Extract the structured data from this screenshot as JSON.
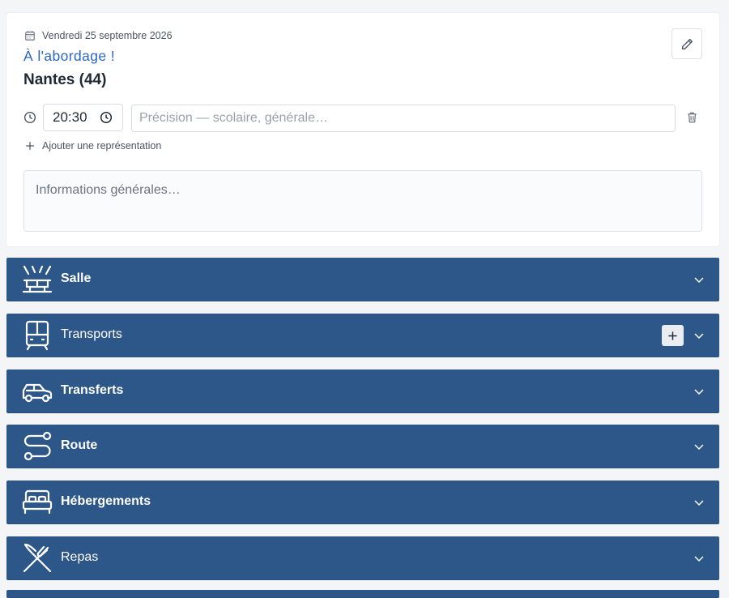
{
  "header": {
    "date": "Vendredi 25 septembre 2026",
    "title": "À l'abordage !",
    "city": "Nantes (44)"
  },
  "performance": {
    "time": "20:30",
    "precision_placeholder": "Précision — scolaire, générale…"
  },
  "add_representation_label": "Ajouter une représentation",
  "info_placeholder": "Informations générales…",
  "sections": [
    {
      "label": "Salle",
      "icon": "venue-icon"
    },
    {
      "label": "Transports",
      "icon": "train-icon"
    },
    {
      "label": "Transferts",
      "icon": "car-icon"
    },
    {
      "label": "Route",
      "icon": "route-icon"
    },
    {
      "label": "Hébergements",
      "icon": "bed-icon"
    },
    {
      "label": "Repas",
      "icon": "utensils-icon"
    }
  ],
  "colors": {
    "section_bg": "#2d5689",
    "title_accent": "#2b66c4"
  }
}
